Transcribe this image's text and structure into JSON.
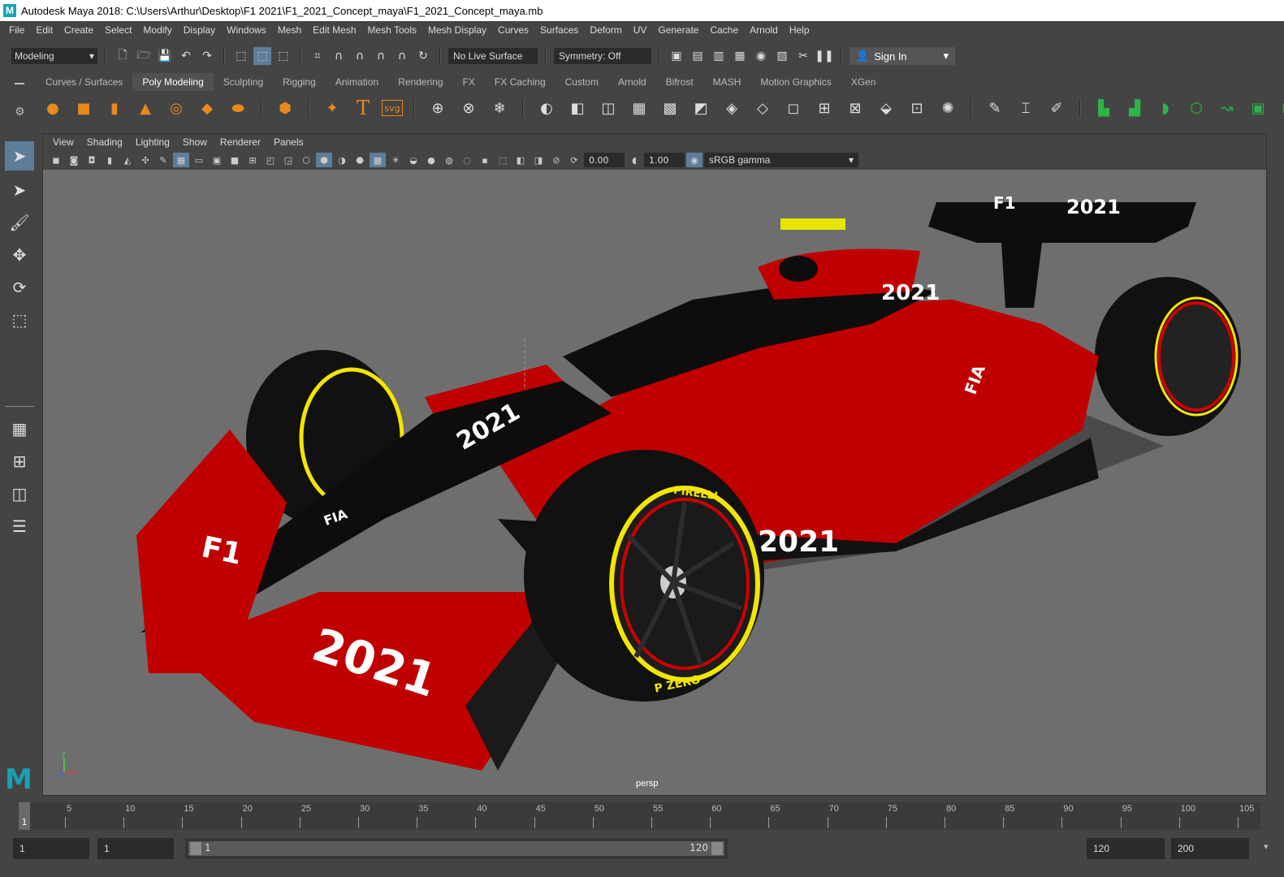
{
  "window": {
    "title": "Autodesk Maya 2018: C:\\Users\\Arthur\\Desktop\\F1 2021\\F1_2021_Concept_maya\\F1_2021_Concept_maya.mb",
    "logo": "M"
  },
  "menubar": [
    "File",
    "Edit",
    "Create",
    "Select",
    "Modify",
    "Display",
    "Windows",
    "Mesh",
    "Edit Mesh",
    "Mesh Tools",
    "Mesh Display",
    "Curves",
    "Surfaces",
    "Deform",
    "UV",
    "Generate",
    "Cache",
    "Arnold",
    "Help"
  ],
  "statusline": {
    "mode": "Modeling",
    "live_surface": "No Live Surface",
    "symmetry": "Symmetry: Off",
    "sign_in": "Sign In"
  },
  "shelf": {
    "tabs": [
      "Curves / Surfaces",
      "Poly Modeling",
      "Sculpting",
      "Rigging",
      "Animation",
      "Rendering",
      "FX",
      "FX Caching",
      "Custom",
      "Arnold",
      "Bifrost",
      "MASH",
      "Motion Graphics",
      "XGen"
    ],
    "active_tab": "Poly Modeling",
    "svg_label": "svg",
    "text_label": "T"
  },
  "panel": {
    "menu": [
      "View",
      "Shading",
      "Lighting",
      "Show",
      "Renderer",
      "Panels"
    ],
    "exposure": "0.00",
    "gamma": "1.00",
    "color_space": "sRGB gamma",
    "camera": "persp"
  },
  "car_decals": {
    "year": "2021",
    "fia": "FIA",
    "tyre_brand": "PIRELLI",
    "tyre_model": "P ZERO"
  },
  "timeline": {
    "ticks": [
      "5",
      "10",
      "15",
      "20",
      "25",
      "30",
      "35",
      "40",
      "45",
      "50",
      "55",
      "60",
      "65",
      "70",
      "75",
      "80",
      "85",
      "90",
      "95",
      "100",
      "105"
    ],
    "current_frame": "1"
  },
  "range": {
    "start_time": "1",
    "playback_start": "1",
    "range_start": "1",
    "range_end": "120",
    "playback_end": "120",
    "end_time": "200"
  },
  "colors": {
    "car_red": "#c00000",
    "tyre_yellow": "#f2e600",
    "viewport_bg": "#6e6e6e",
    "ui_bg": "#444444",
    "active_blue": "#5e7d9b",
    "maya_teal": "#1aa0b4"
  }
}
